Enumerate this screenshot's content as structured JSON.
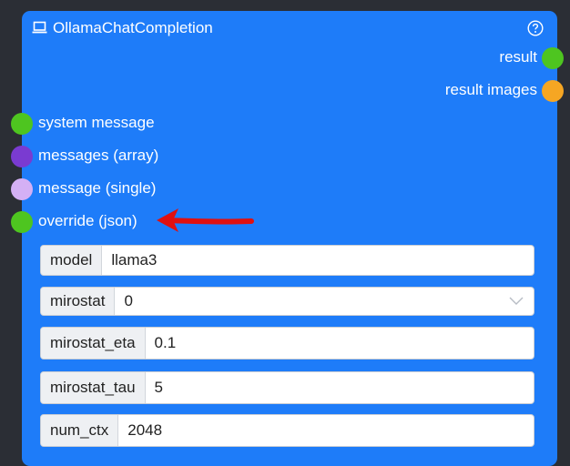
{
  "node": {
    "title": "OllamaChatCompletion",
    "title_icon": "laptop-icon",
    "help_icon": "question-circle-icon"
  },
  "outputs": [
    {
      "label": "result",
      "color": "#4ec520"
    },
    {
      "label": "result images",
      "color": "#f6a623"
    }
  ],
  "inputs": [
    {
      "label": "system message",
      "color": "#4ec520"
    },
    {
      "label": "messages (array)",
      "color": "#7a3bd1"
    },
    {
      "label": "message (single)",
      "color": "#d4b0f5"
    },
    {
      "label": "override (json)",
      "color": "#4ec520"
    }
  ],
  "fields": [
    {
      "label": "model",
      "value": "llama3",
      "type": "text"
    },
    {
      "label": "mirostat",
      "value": "0",
      "type": "select"
    },
    {
      "label": "mirostat_eta",
      "value": "0.1",
      "type": "text"
    },
    {
      "label": "mirostat_tau",
      "value": "5",
      "type": "text"
    },
    {
      "label": "num_ctx",
      "value": "2048",
      "type": "text"
    }
  ],
  "annotation": {
    "arrow_color": "#e01010",
    "arrow_icon": "red-arrow-icon"
  }
}
